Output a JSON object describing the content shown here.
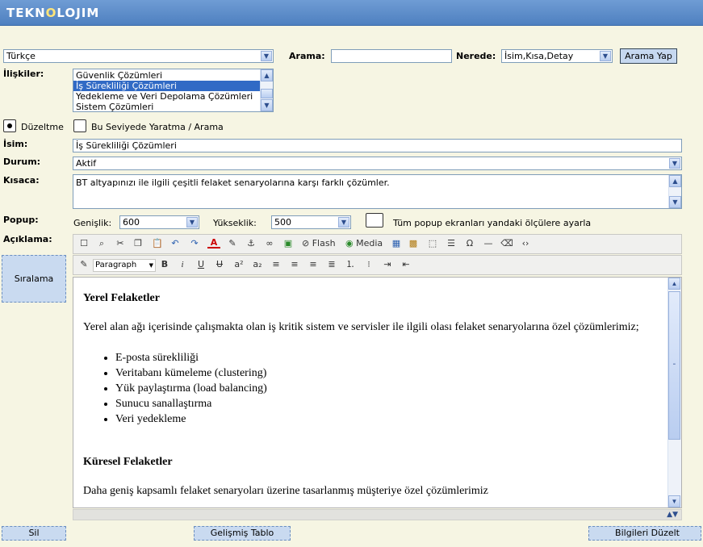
{
  "header": {
    "logo_a": "TEKN",
    "logo_b": "O",
    "logo_c": "LOJIM"
  },
  "language": {
    "value": "Türkçe"
  },
  "search": {
    "label": "Arama:",
    "value": "",
    "where_label": "Nerede:",
    "where_value": "İsim,Kısa,Detay",
    "button": "Arama Yap"
  },
  "relations": {
    "label": "İlişkiler:",
    "items": [
      "Güvenlik Çözümleri",
      "İş Sürekliliği Çözümleri",
      "Yedekleme ve Veri Depolama Çözümleri",
      "Sistem Çözümleri"
    ]
  },
  "mode": {
    "edit_label": "Düzeltme",
    "create_label": "Bu Seviyede Yaratma / Arama"
  },
  "name": {
    "label": "İsim:",
    "value": "İş Sürekliliği Çözümleri"
  },
  "status": {
    "label": "Durum:",
    "value": "Aktif"
  },
  "short": {
    "label": "Kısaca:",
    "value": "BT altyapınızı ile ilgili çeşitli felaket senaryolarına karşı farklı çözümler."
  },
  "popup": {
    "label": "Popup:",
    "width_label": "Genişlik:",
    "width_value": "600",
    "height_label": "Yükseklik:",
    "height_value": "500",
    "apply_label": "Tüm popup ekranları yandaki ölçülere ayarla"
  },
  "description": {
    "label": "Açıklama:"
  },
  "sort_button": "Sıralama",
  "toolbar": {
    "flash": "Flash",
    "media": "Media",
    "paragraph": "Paragraph"
  },
  "content": {
    "h1": "Yerel Felaketler",
    "p1": "Yerel alan ağı içerisinde çalışmakta olan iş kritik sistem ve servisler ile ilgili olası felaket senaryolarına özel çözümlerimiz;",
    "items": [
      "E-posta sürekliliği",
      "Veritabanı kümeleme (clustering)",
      "Yük paylaştırma (load balancing)",
      "Sunucu sanallaştırma",
      "Veri yedekleme"
    ],
    "h2": "Küresel Felaketler",
    "p2": "Daha geniş kapsamlı felaket senaryoları üzerine tasarlanmış müşteriye özel çözümlerimiz"
  },
  "footer": {
    "delete": "Sil",
    "advanced_table": "Gelişmiş Tablo",
    "update": "Bilgileri Düzelt"
  }
}
